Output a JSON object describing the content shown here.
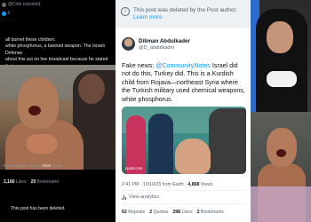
{
  "left_tweet": {
    "reposted_label": "@Cole reposted",
    "handle": "k",
    "body": "all burnet these children.\nwhite phosphorus, a banned weapon. The Israeli Defense\nabout this act on live broadcast because he stated that\nare 'subhuman creatures' according to Yehidis.",
    "meta_prefix": "from Istanbul, Türkiye",
    "meta_views": "253K",
    "meta_views_label": "Views",
    "stats_reposts": "2,180",
    "stats_reposts_label": "Likes",
    "stats_likes": "29",
    "stats_likes_label": "Bookmarks",
    "deleted_notice": "This post has been deleted."
  },
  "center_tweet": {
    "notice_text": "This post was deleted by the Post author.",
    "notice_link": "Learn more",
    "author_name": "Diliman Abdulkader",
    "author_handle": "@D_abdulkader",
    "tweet_prefix": "Fake news: ",
    "tweet_mention": "@CommunityNotes",
    "tweet_rest": " Israel did not do this, Turkey did. This is a Kurdish child from Rojava—northeast Syria where the Turkish military used chemical weapons, white phosphorus.",
    "media_watermark": "npost.com",
    "timestamp": "2:41 PM · 10/10/23 from Earth · ",
    "views_count": "4,868",
    "views_label": "Views",
    "analytics_label": "View analytics",
    "replies_count": "62",
    "replies_label": "Reposts",
    "quotes_count": "2",
    "quotes_label": "Quotes",
    "likes_count": "298",
    "likes_label": "Likes",
    "bookmarks_count": "2",
    "bookmarks_label": "Bookmarks"
  },
  "colors": {
    "x_blue": "#1d9bf0",
    "dark_bg": "#000000",
    "light_bg": "#ffffff"
  }
}
